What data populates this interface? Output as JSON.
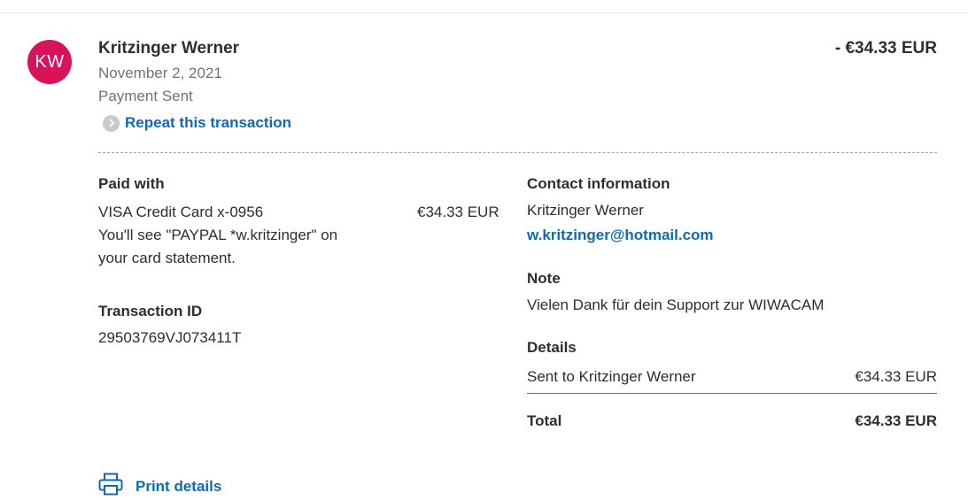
{
  "header": {
    "avatar_initials": "KW",
    "name": "Kritzinger Werner",
    "date": "November 2, 2021",
    "status": "Payment Sent",
    "repeat_label": "Repeat this transaction",
    "amount": "- €34.33 EUR"
  },
  "paid_with": {
    "heading": "Paid with",
    "card": "VISA Credit Card x-0956",
    "card_amount": "€34.33 EUR",
    "statement_line1": "You'll see \"PAYPAL *w.kritzinger\" on",
    "statement_line2": "your card statement."
  },
  "transaction": {
    "heading": "Transaction ID",
    "id": "29503769VJ073411T"
  },
  "contact": {
    "heading": "Contact information",
    "name": "Kritzinger Werner",
    "email": "w.kritzinger@hotmail.com"
  },
  "note": {
    "heading": "Note",
    "text": "Vielen Dank für dein Support zur WIWACAM"
  },
  "details": {
    "heading": "Details",
    "sent_to_label": "Sent to Kritzinger Werner",
    "sent_to_amount": "€34.33 EUR",
    "total_label": "Total",
    "total_amount": "€34.33 EUR"
  },
  "actions": {
    "print_label": "Print details"
  },
  "colors": {
    "avatar_bg": "#d8125b",
    "link": "#0e6bb1",
    "muted": "#6c7378",
    "text": "#2c2e2f"
  },
  "icons": {
    "repeat": "chevron-right-circle-icon",
    "print": "printer-icon"
  }
}
